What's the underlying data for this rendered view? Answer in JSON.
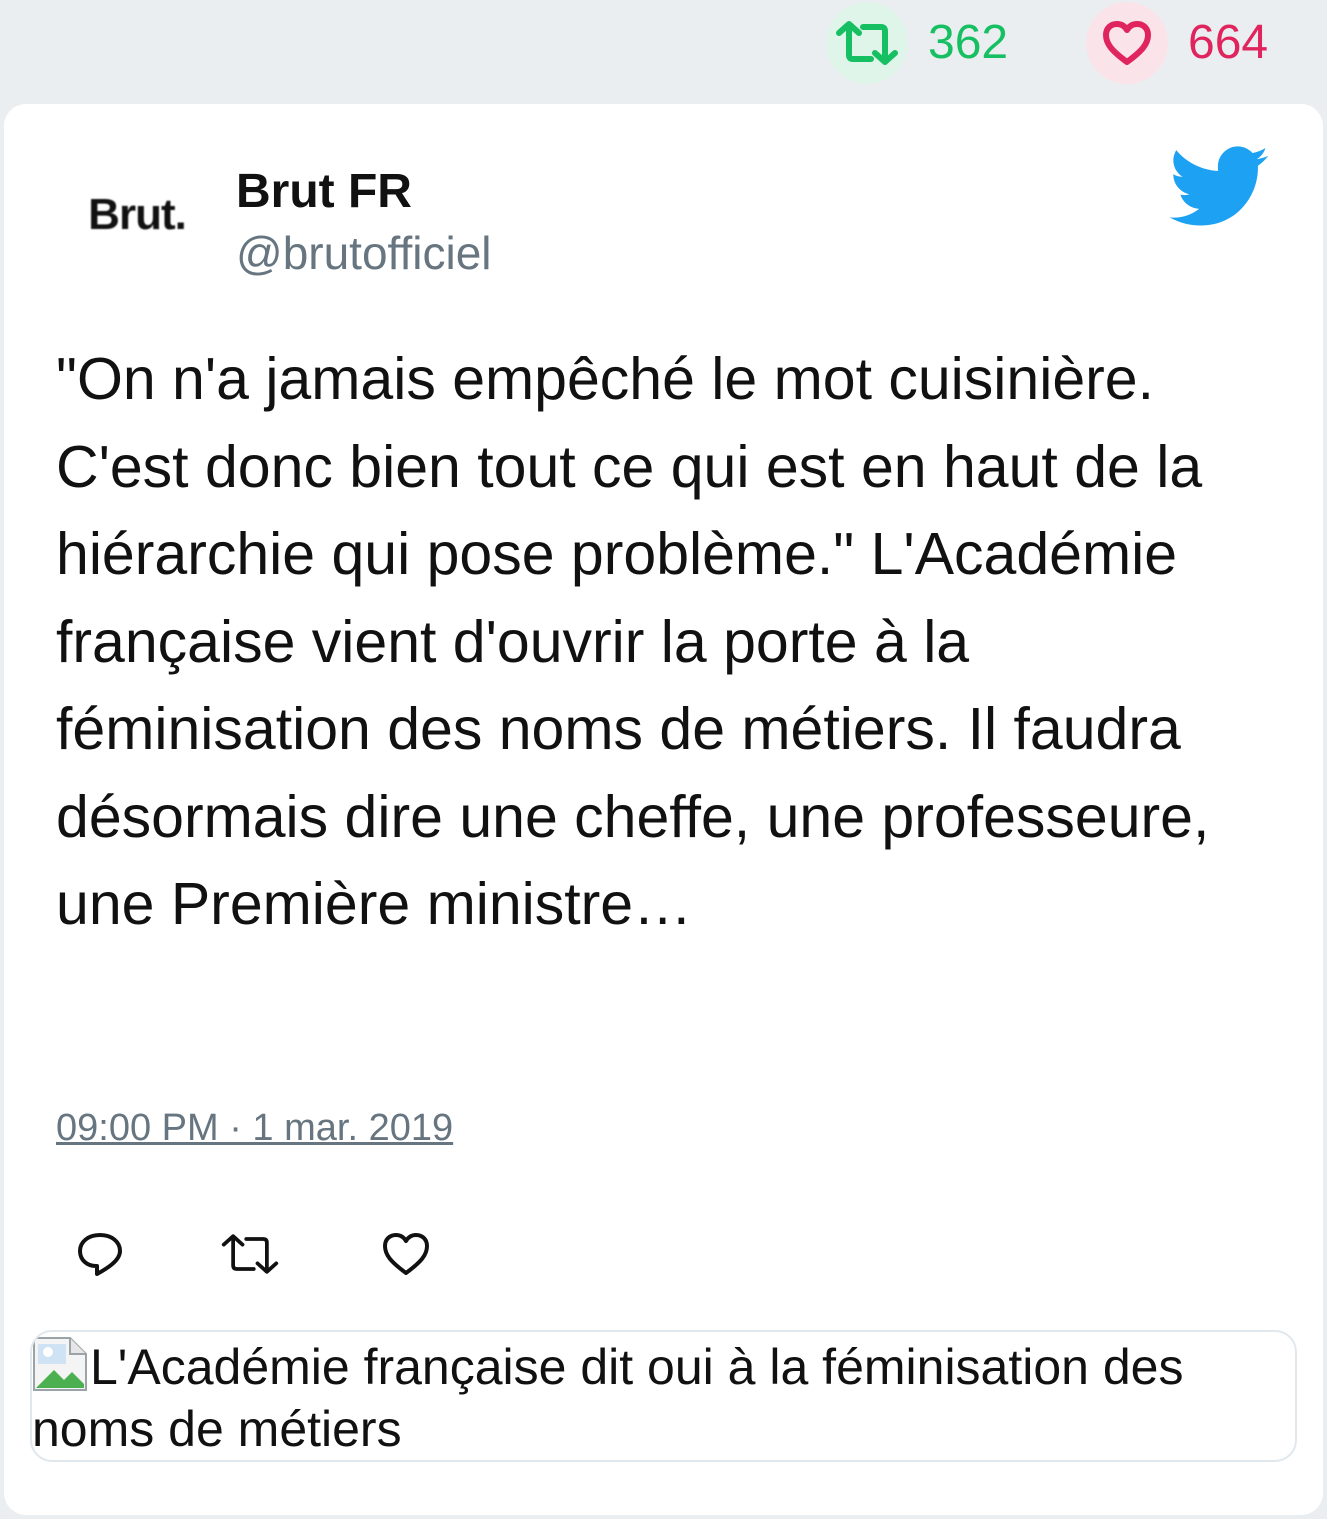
{
  "stats": {
    "retweets": "362",
    "likes": "664"
  },
  "author": {
    "avatar_text": "Brut.",
    "name": "Brut FR",
    "handle": "@brutofficiel"
  },
  "tweet": {
    "text": "\"On n'a jamais empêché le mot cuisinière. C'est donc bien tout ce qui est en haut de la hiérarchie qui pose problème.\" L'Académie française vient d'ouvrir la porte à la féminisation des noms de métiers. Il faudra désormais dire une cheffe, une professeure, une Première ministre…",
    "timestamp": "09:00 PM · 1 mar. 2019"
  },
  "link_card": {
    "alt_text": "L'Académie française dit oui à la féminisation des noms de métiers"
  },
  "colors": {
    "retweet_green": "#17bf63",
    "like_pink": "#e0245e",
    "twitter_blue": "#1da1f2",
    "handle_gray": "#66757f"
  },
  "icons": {
    "retweet": "retweet-icon",
    "like": "heart-icon",
    "reply": "reply-icon",
    "brand": "twitter-bird-icon",
    "broken_image": "broken-image-icon"
  }
}
